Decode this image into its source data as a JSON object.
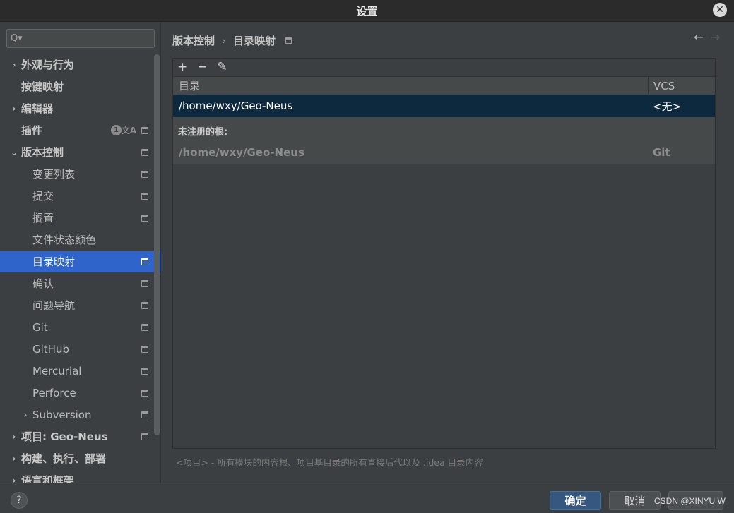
{
  "window": {
    "title": "设置",
    "close_icon": "✕"
  },
  "sidebar": {
    "search": {
      "value": "",
      "placeholder": "",
      "icon": "Q▾"
    },
    "items": [
      {
        "label": "外观与行为",
        "level": 0,
        "arrow": "›",
        "bold": true,
        "proj": false
      },
      {
        "label": "按键映射",
        "level": 0,
        "arrow": "",
        "bold": true,
        "proj": false
      },
      {
        "label": "编辑器",
        "level": 0,
        "arrow": "›",
        "bold": true,
        "proj": false
      },
      {
        "label": "插件",
        "level": 0,
        "arrow": "",
        "bold": true,
        "proj": true,
        "badge": "1",
        "translate": "文A"
      },
      {
        "label": "版本控制",
        "level": 0,
        "arrow": "⌄",
        "bold": true,
        "proj": true
      },
      {
        "label": "变更列表",
        "level": 1,
        "arrow": "",
        "proj": true
      },
      {
        "label": "提交",
        "level": 1,
        "arrow": "",
        "proj": true
      },
      {
        "label": "搁置",
        "level": 1,
        "arrow": "",
        "proj": true
      },
      {
        "label": "文件状态颜色",
        "level": 1,
        "arrow": "",
        "proj": false
      },
      {
        "label": "目录映射",
        "level": 1,
        "arrow": "",
        "proj": true,
        "selected": true
      },
      {
        "label": "确认",
        "level": 1,
        "arrow": "",
        "proj": true
      },
      {
        "label": "问题导航",
        "level": 1,
        "arrow": "",
        "proj": true
      },
      {
        "label": "Git",
        "level": 1,
        "arrow": "",
        "proj": true
      },
      {
        "label": "GitHub",
        "level": 1,
        "arrow": "",
        "proj": true
      },
      {
        "label": "Mercurial",
        "level": 1,
        "arrow": "",
        "proj": true
      },
      {
        "label": "Perforce",
        "level": 1,
        "arrow": "",
        "proj": true
      },
      {
        "label": "Subversion",
        "level": 1,
        "arrow": "›",
        "proj": true
      },
      {
        "label": "项目: Geo-Neus",
        "level": 0,
        "arrow": "›",
        "bold": true,
        "proj": true
      },
      {
        "label": "构建、执行、部署",
        "level": 0,
        "arrow": "›",
        "bold": true,
        "proj": false
      },
      {
        "label": "语言和框架",
        "level": 0,
        "arrow": "›",
        "bold": true,
        "proj": false
      }
    ]
  },
  "main": {
    "breadcrumb": {
      "parent": "版本控制",
      "separator": "›",
      "current": "目录映射"
    },
    "nav": {
      "back": "←",
      "forward": "→"
    },
    "toolbar": {
      "add": "+",
      "remove": "−",
      "edit": "✎"
    },
    "table": {
      "headers": {
        "directory": "目录",
        "vcs": "VCS"
      },
      "rows": [
        {
          "directory": "/home/wxy/Geo-Neus",
          "vcs": "<无>"
        }
      ]
    },
    "unregistered": {
      "heading": "未注册的根:",
      "rows": [
        {
          "directory": "/home/wxy/Geo-Neus",
          "vcs": "Git"
        }
      ]
    },
    "note": "<项目> - 所有模块的内容根、项目基目录的所有直接后代以及 .idea 目录内容"
  },
  "footer": {
    "help": "?",
    "ok": "确定",
    "cancel": "取消",
    "watermark": "CSDN @XINYU W"
  }
}
